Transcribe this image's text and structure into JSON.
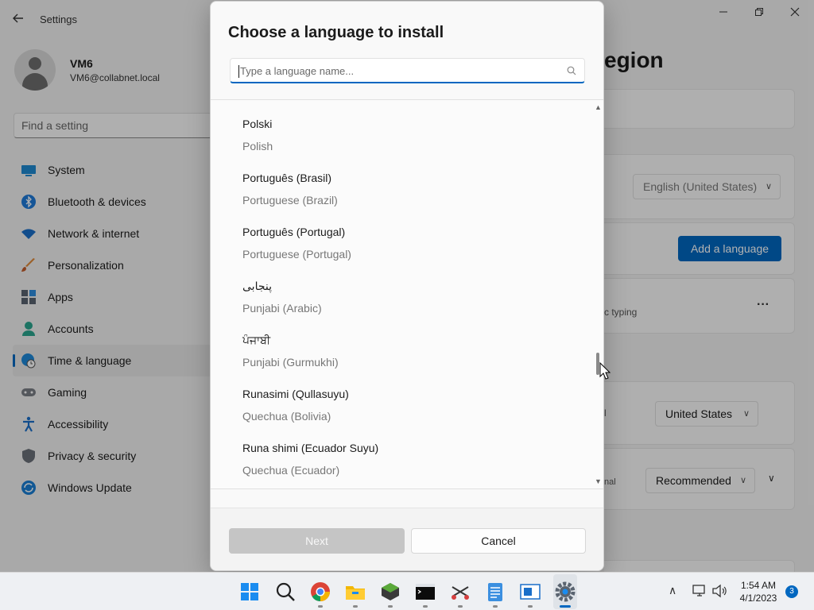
{
  "settings": {
    "window_title": "Settings",
    "user": {
      "name": "VM6",
      "email": "VM6@collabnet.local"
    },
    "search_placeholder": "Find a setting",
    "nav": [
      {
        "label": "System",
        "icon": "system-icon"
      },
      {
        "label": "Bluetooth & devices",
        "icon": "bluetooth-icon"
      },
      {
        "label": "Network & internet",
        "icon": "wifi-icon"
      },
      {
        "label": "Personalization",
        "icon": "brush-icon"
      },
      {
        "label": "Apps",
        "icon": "apps-icon"
      },
      {
        "label": "Accounts",
        "icon": "account-icon"
      },
      {
        "label": "Time & language",
        "icon": "clock-icon",
        "selected": true
      },
      {
        "label": "Gaming",
        "icon": "gamepad-icon"
      },
      {
        "label": "Accessibility",
        "icon": "accessibility-icon"
      },
      {
        "label": "Privacy & security",
        "icon": "shield-icon"
      },
      {
        "label": "Windows Update",
        "icon": "update-icon"
      }
    ],
    "page_title_fragment": "egion",
    "display_language_value": "English (United States)",
    "add_language_label": "Add a language",
    "typing_fragment": "c typing",
    "more_label": "···",
    "country_fragment": "l",
    "country_value": "United States",
    "regional_fragment": "nal",
    "regional_value": "Recommended"
  },
  "dialog": {
    "title": "Choose a language to install",
    "search_placeholder": "Type a language name...",
    "languages": [
      {
        "native": "Polski",
        "english": "Polish"
      },
      {
        "native": "Português (Brasil)",
        "english": "Portuguese (Brazil)"
      },
      {
        "native": "Português (Portugal)",
        "english": "Portuguese (Portugal)"
      },
      {
        "native": "پنجابی",
        "english": "Punjabi (Arabic)"
      },
      {
        "native": "ਪੰਜਾਬੀ",
        "english": "Punjabi (Gurmukhi)"
      },
      {
        "native": "Runasimi (Qullasuyu)",
        "english": "Quechua (Bolivia)"
      },
      {
        "native": "Runa shimi (Ecuador Suyu)",
        "english": "Quechua (Ecuador)"
      }
    ],
    "next_label": "Next",
    "cancel_label": "Cancel"
  },
  "taskbar": {
    "icons": [
      "start-icon",
      "search-icon",
      "chrome-icon",
      "file-explorer-icon",
      "minecraft-icon",
      "terminal-icon",
      "snipping-icon",
      "notepad-icon",
      "window-app-icon",
      "settings-icon"
    ],
    "time": "1:54 AM",
    "date": "4/1/2023",
    "notification_count": "3"
  },
  "colors": {
    "accent": "#0067c0",
    "overlay": "rgba(0,0,0,0.30)"
  }
}
